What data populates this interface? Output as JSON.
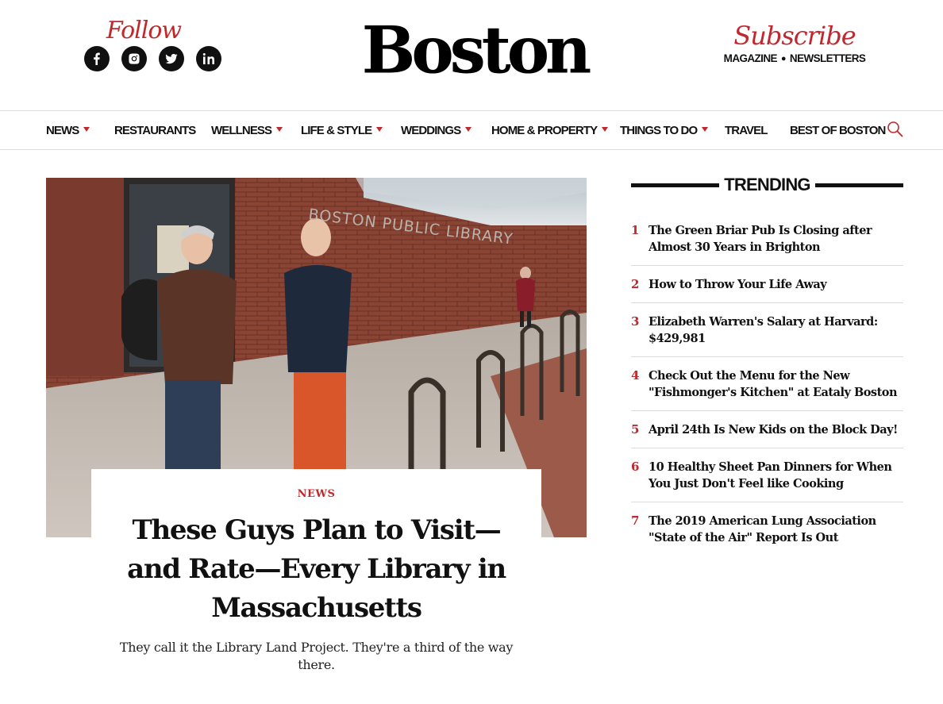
{
  "header": {
    "follow_label": "Follow",
    "logo": "Boston",
    "subscribe_label": "Subscribe",
    "sub_links": [
      "MAGAZINE",
      "NEWSLETTERS"
    ],
    "social": [
      "facebook-icon",
      "instagram-icon",
      "twitter-icon",
      "linkedin-icon"
    ]
  },
  "nav": {
    "items": [
      {
        "label": "NEWS",
        "has_dropdown": true
      },
      {
        "label": "RESTAURANTS",
        "has_dropdown": false
      },
      {
        "label": "WELLNESS",
        "has_dropdown": true
      },
      {
        "label": "LIFE & STYLE",
        "has_dropdown": true
      },
      {
        "label": "WEDDINGS",
        "has_dropdown": true
      },
      {
        "label": "HOME & PROPERTY",
        "has_dropdown": true
      },
      {
        "label": "THINGS TO DO",
        "has_dropdown": true
      },
      {
        "label": "TRAVEL",
        "has_dropdown": false
      },
      {
        "label": "BEST OF BOSTON",
        "has_dropdown": false
      }
    ],
    "search_icon": "search-icon"
  },
  "hero": {
    "sign_text": "BOSTON PUBLIC LIBRARY",
    "category": "NEWS",
    "title": "These Guys Plan to Visit—and Rate—Every Library in Massachusetts",
    "dek": "They call it the Library Land Project. They're a third of the way there."
  },
  "trending": {
    "title": "TRENDING",
    "items": [
      {
        "num": "1",
        "text": "The Green Briar Pub Is Closing after Almost 30 Years in Brighton"
      },
      {
        "num": "2",
        "text": "How to Throw Your Life Away"
      },
      {
        "num": "3",
        "text": "Elizabeth Warren's Salary at Harvard: $429,981"
      },
      {
        "num": "4",
        "text": "Check Out the Menu for the New \"Fishmonger's Kitchen\" at Eataly Boston"
      },
      {
        "num": "5",
        "text": "April 24th Is New Kids on the Block Day!"
      },
      {
        "num": "6",
        "text": "10 Healthy Sheet Pan Dinners for When You Just Don't Feel like Cooking"
      },
      {
        "num": "7",
        "text": "The 2019 American Lung Association \"State of the Air\" Report Is Out"
      }
    ]
  },
  "colors": {
    "accent": "#c0282d",
    "text": "#111111"
  }
}
